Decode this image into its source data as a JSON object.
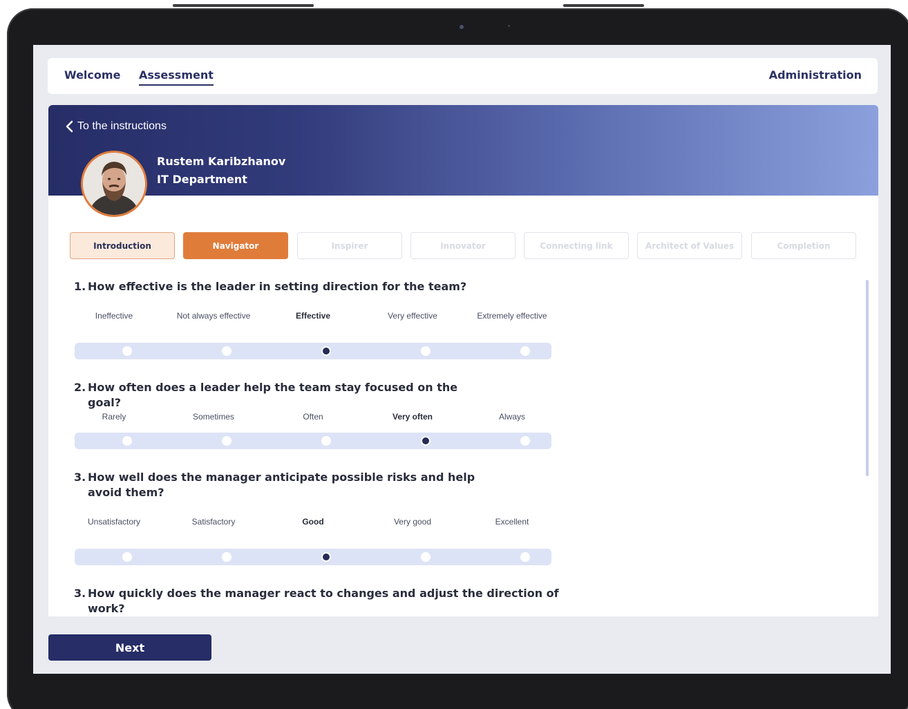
{
  "nav": {
    "welcome": "Welcome",
    "assessment": "Assessment",
    "administration": "Administration"
  },
  "banner": {
    "back_label": "To the instructions",
    "user_name": "Rustem Karibzhanov",
    "user_department": "IT Department"
  },
  "steps": [
    {
      "label": "Introduction",
      "state": "done"
    },
    {
      "label": "Navigator",
      "state": "active"
    },
    {
      "label": "Inspirer",
      "state": "upcoming"
    },
    {
      "label": "Innovator",
      "state": "upcoming"
    },
    {
      "label": "Connecting link",
      "state": "upcoming"
    },
    {
      "label": "Architect of Values",
      "state": "upcoming"
    },
    {
      "label": "Completion",
      "state": "upcoming"
    }
  ],
  "questions": [
    {
      "number": "1.",
      "text": "How effective is the leader in setting direction for the team?",
      "options": [
        "Ineffective",
        "Not always effective",
        "Effective",
        "Very effective",
        "Extremely effective"
      ],
      "selected": "Effective"
    },
    {
      "number": "2.",
      "text": "How often does a leader help the team stay focused on the goal?",
      "options": [
        "Rarely",
        "Sometimes",
        "Often",
        "Very often",
        "Always"
      ],
      "selected": "Very often"
    },
    {
      "number": "3.",
      "text": "How well does the manager anticipate possible risks and help avoid them?",
      "options": [
        "Unsatisfactory",
        "Satisfactory",
        "Good",
        "Very good",
        "Excellent"
      ],
      "selected": "Good"
    },
    {
      "number": "3.",
      "text": "How quickly does the manager react to changes and adjust the direction of work?"
    }
  ],
  "next_label": "Next",
  "colors": {
    "primary": "#262d67",
    "accent": "#e07c3a",
    "track": "#dde3f6"
  }
}
